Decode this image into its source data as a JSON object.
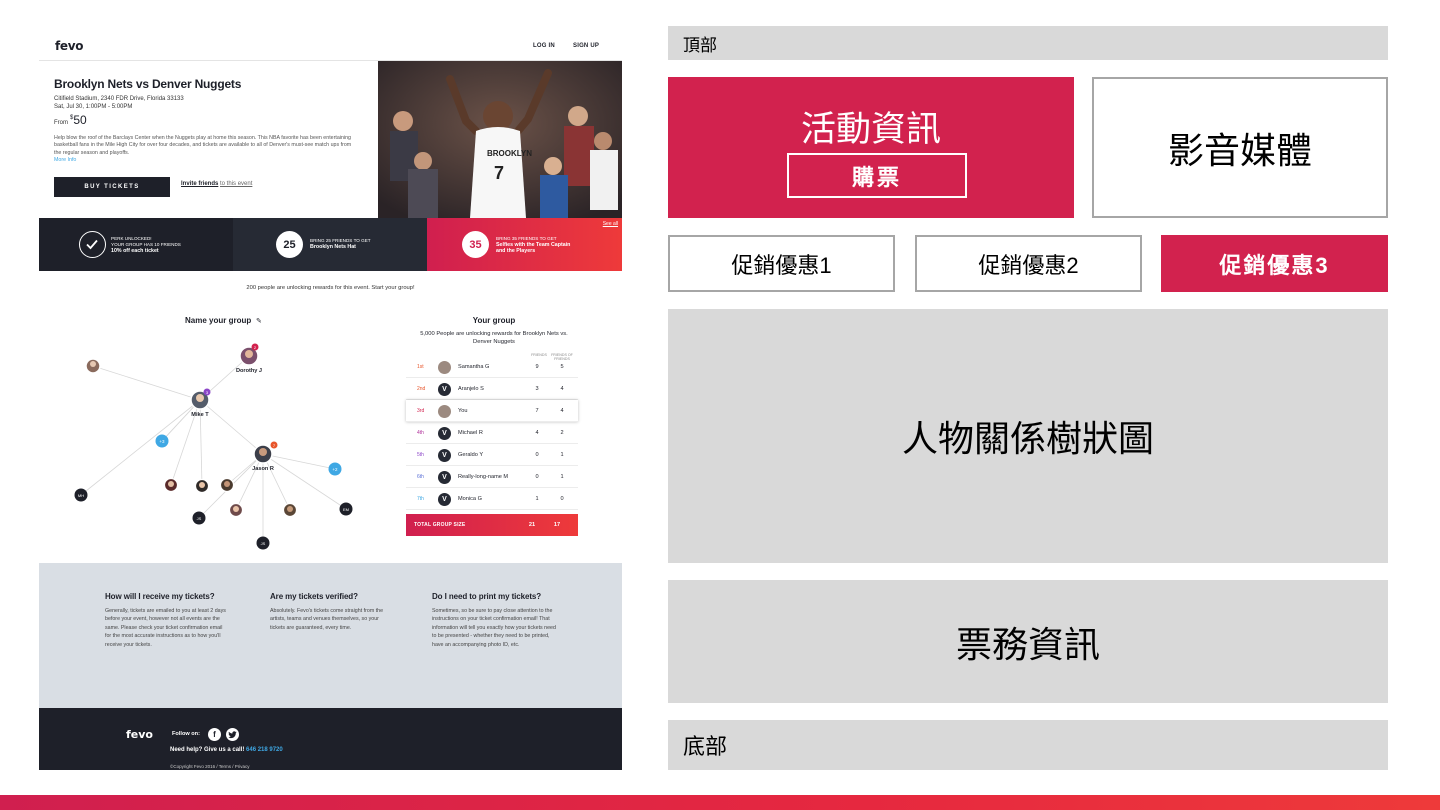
{
  "site": {
    "logo": "fevo",
    "nav": {
      "login": "LOG IN",
      "signup": "SIGN UP"
    },
    "event": {
      "title": "Brooklyn Nets vs Denver Nuggets",
      "venue": "Citifield Stadium, 2340 FDR Drive, Florida 33133",
      "datetime": "Sat, Jul 30, 1:00PM - 5:00PM",
      "price_from": "From",
      "price_currency": "$",
      "price_value": "50",
      "description": "Help blow the roof of the Barclays Center when the Nuggets play at home this season. This NBA favorite has been entertaining basketball fans in the Mile High City for over four decades, and tickets are available to all of Denver's must-see match ups from the regular season and playoffs.",
      "more_info": "More Info",
      "buy_button": "BUY TICKETS",
      "invite_bold": "Invite friends",
      "invite_rest": "to this event"
    },
    "perks": [
      {
        "line1": "PERK UNLOCKED!",
        "line2": "YOUR GROUP HAS 10 FRIENDS",
        "line3": "10% off each ticket"
      },
      {
        "count": "25",
        "line1": "BRING 25 FRIENDS TO GET",
        "line2": "Brooklyn Nets Hat"
      },
      {
        "count": "35",
        "line1": "BRING 35 FRIENDS TO GET",
        "line2": "Selfies with the Team Captain",
        "line3": "and the Players",
        "see_all": "See all"
      }
    ],
    "unlock_line": "200 people are unlocking rewards for this event. Start your group!",
    "tree": {
      "title": "Name your group",
      "nodes": [
        {
          "label": "Dorothy J",
          "badge": "2"
        },
        {
          "label": "Mike T",
          "badge": "3"
        },
        {
          "label": "Jason R",
          "badge": "7"
        },
        {
          "label": "+3"
        },
        {
          "label": "+2"
        },
        {
          "label": "MH"
        },
        {
          "label": "JS"
        },
        {
          "label": "JS"
        },
        {
          "label": "EM"
        }
      ]
    },
    "group": {
      "title": "Your group",
      "subtitle": "5,000 People are unlocking rewards for Brooklyn Nets vs. Denver Nuggets",
      "col_friends": "FRIENDS",
      "col_fof": "FRIENDS OF FRIENDS",
      "rows": [
        {
          "pos": "1st",
          "name": "Samantha G",
          "friends": "9",
          "fof": "5",
          "avatar": "",
          "pos_color": "#e8552b"
        },
        {
          "pos": "2nd",
          "name": "Aranjelo S",
          "friends": "3",
          "fof": "4",
          "avatar": "V",
          "pos_color": "#e8552b"
        },
        {
          "pos": "3rd",
          "name": "You",
          "friends": "7",
          "fof": "4",
          "avatar": "",
          "pos_color": "#d2224e"
        },
        {
          "pos": "4th",
          "name": "Michael R",
          "friends": "4",
          "fof": "2",
          "avatar": "V",
          "pos_color": "#b0329b"
        },
        {
          "pos": "5th",
          "name": "Geraldo Y",
          "friends": "0",
          "fof": "1",
          "avatar": "V",
          "pos_color": "#8c46c8"
        },
        {
          "pos": "6th",
          "name": "Really-long-name M",
          "friends": "0",
          "fof": "1",
          "avatar": "V",
          "pos_color": "#5a6fd6"
        },
        {
          "pos": "7th",
          "name": "Monica G",
          "friends": "1",
          "fof": "0",
          "avatar": "V",
          "pos_color": "#3fa8e4"
        }
      ],
      "total_label": "TOTAL GROUP SIZE",
      "total_friends": "21",
      "total_fof": "17"
    },
    "faq": [
      {
        "q": "How will I receive my tickets?",
        "a": "Generally, tickets are emailed to you at least 2 days before your event, however not all events are the same. Please check your ticket confirmation email for the most accurate instructions as to how you'll receive your tickets."
      },
      {
        "q": "Are my tickets verified?",
        "a": "Absolutely. Fevo's tickets come straight from the artists, teams and venues themselves, so your tickets are guaranteed, every time."
      },
      {
        "q": "Do I need to print my tickets?",
        "a": "Sometimes, so be sure to pay close attention to the instructions on your ticket confirmation email! That information will tell you exactly how your tickets need to be presented - whether they need to be printed, have an accompanying photo ID, etc."
      }
    ],
    "footer": {
      "logo": "fevo",
      "follow": "Follow on:",
      "facebook": "f",
      "help_text": "Need help? Give us a call!",
      "phone": "646 218 9720",
      "copyright": "©Copyright Fevo 2016 / Terms / Privacy"
    }
  },
  "wireframe": {
    "top": "頂部",
    "event_info": "活動資訊",
    "buy": "購票",
    "media": "影音媒體",
    "promo1": "促銷優惠1",
    "promo2": "促銷優惠2",
    "promo3": "促銷優惠3",
    "tree": "人物關係樹狀圖",
    "ticket_info": "票務資訊",
    "bottom": "底部"
  },
  "colors": {
    "brand_red": "#d2224e",
    "dark": "#1e2029",
    "link_blue": "#3fa8e4",
    "wire_gray": "#d9d9d9"
  }
}
